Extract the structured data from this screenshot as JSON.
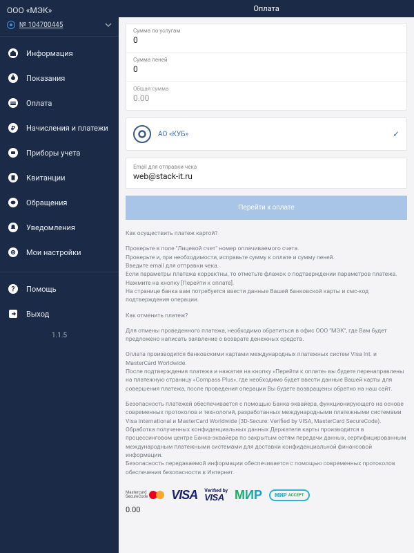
{
  "company": "ООО «МЭК»",
  "account": "№ 104700445",
  "version": "1.1.5",
  "nav": {
    "info": "Информация",
    "readings": "Показания",
    "payment": "Оплата",
    "charges": "Начисления и платежи",
    "meters": "Приборы учета",
    "receipts": "Квитанции",
    "requests": "Обращения",
    "notifications": "Уведомления",
    "settings": "Мои настройки",
    "help": "Помощь",
    "exit": "Выход"
  },
  "page_title": "Оплата",
  "fields": {
    "services_label": "Сумма по услугам",
    "services_value": "0",
    "penalties_label": "Сумма пеней",
    "penalties_value": "0",
    "total_label": "Общая сумма",
    "total_value": "0.00"
  },
  "bank_name": "АО «КУБ»",
  "email_label": "Email для отправки чека",
  "email_value": "web@stack-it.ru",
  "pay_button": "Перейти к оплате",
  "help": {
    "q1": "Как осуществить платеж картой?",
    "p1": "Проверьте в поле \"Лицевой счет\" номер оплачиваемого счета.\nПроверьте и, при необходимости, исправьте сумму к оплате и сумму пеней.\nВведите email для отправки чека.\nЕсли параметры платежа корректны, то отметьте флажок о подтверждении параметров платежа.\nНажмите на кнопку [Перейти к оплате].\nНа странице банка вам потребуется ввести данные Вашей банковской карты и смс-код подтверждения операции.",
    "q2": "Как отменить платеж?",
    "p2": "Для отмены проведенного платежа, необходимо обратиться в офис ООО \"МЭК\", где Вам будет предложено написать заявление о возврате денежных средств.",
    "p3": "Оплата производится банковскими картами международных платежных систем Visa Int. и MasterCard Worldwide.\nПосле подтверждения платежа и нажатия на кнопку «Перейти к оплате» вы будете перенаправлены на платежную страницу «Compass Plus», где необходимо будет ввести данные Вашей карты для совершения платежа, после проведения операции Вы будете возвращены обратно на наш сайт.",
    "p4": "Безопасность платежей обеспечивается с помощью Банка-эквайера, функционирующего на основе современных протоколов и технологий, разработанных международными платежными системами Visa International и MasterCard Worldwide (3D-Secure: Verified by VISA, MasterCard SecureCode).\nОбработка полученных конфиденциальных данных Держателя карты производится в процессинговом центре Банка-эквайера по закрытым сетям передачи данных, сертифицированным международным платежными системами для доставки конфиденциальной финансовой информации.\nБезопасность передаваемой информации обеспечивается с помощью современных протоколов обеспечения безопасности в Интернет."
  },
  "footer_zero": "0.00"
}
